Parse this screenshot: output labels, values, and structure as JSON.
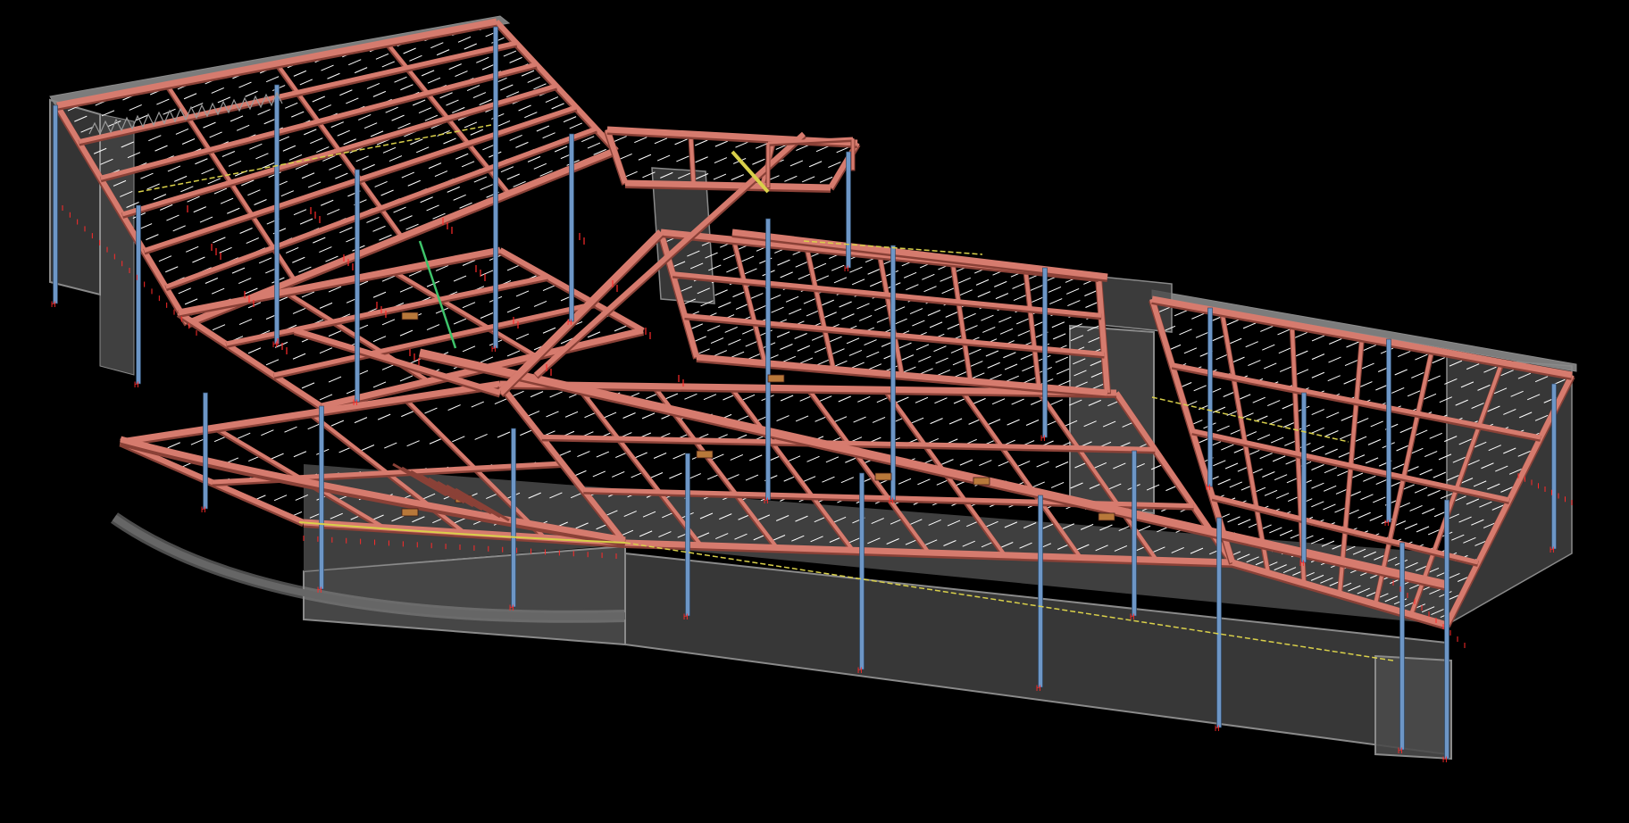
{
  "view": {
    "background": "#000000"
  },
  "palette": {
    "beam_fill": "#d67b6e",
    "beam_dark": "#8a4137",
    "beam_edge": "#3d1a14",
    "column": "#6d96c6",
    "column_edge": "#27415f",
    "slab_line": "#ffffff",
    "wall_fill": "#4a4a4a",
    "wall_face": "#3a3a3a",
    "wall_top": "#8a8a8a",
    "glass": "#b6b6b6",
    "marker": "#ff2a2a",
    "highlight": "#d9d04a",
    "bracing_green": "#3ec46a",
    "connection": "#b8783a"
  },
  "model": {
    "type": "steel-structure-3d",
    "visible_text": []
  }
}
